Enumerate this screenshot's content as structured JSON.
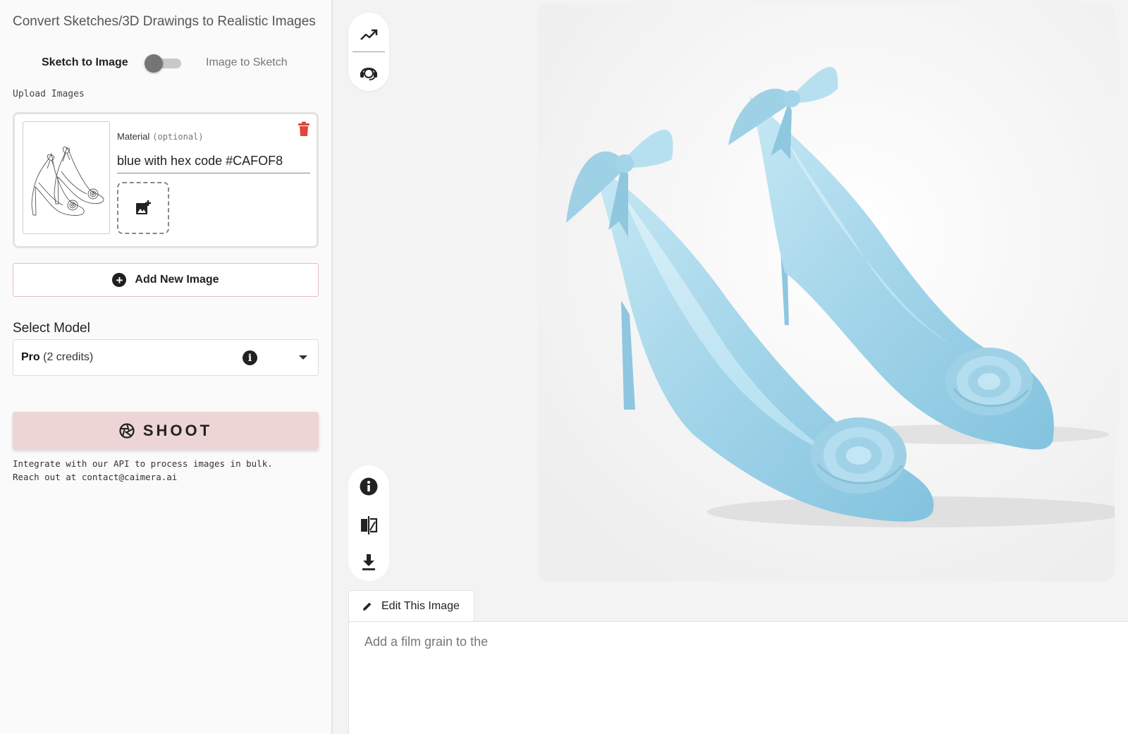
{
  "sidebar": {
    "title": "Convert Sketches/3D Drawings to Realistic Images",
    "mode_toggle": {
      "left_label": "Sketch to Image",
      "right_label": "Image to Sketch"
    },
    "upload_label": "Upload Images",
    "upload_card": {
      "material_label": "Material",
      "material_optional": "(optional)",
      "material_value": "blue with hex code #CAFOF8"
    },
    "add_new_image_label": "Add New Image",
    "select_model": {
      "label": "Select Model",
      "value_bold": "Pro",
      "value_rest": "(2 credits)"
    },
    "shoot_label": "SHOOT",
    "api_note_line1": "Integrate with our API to process images in bulk.",
    "api_note_line2": "Reach out at contact@caimera.ai"
  },
  "toolbar_top": [
    "trending-icon",
    "support-agent-icon"
  ],
  "toolbar_bottom": [
    "info-icon",
    "compare-icon",
    "download-icon"
  ],
  "edit": {
    "tab_label": "Edit This Image",
    "input_value": "Add a film grain to the"
  },
  "colors": {
    "shoot_bg": "#edd5d5",
    "add_border": "#e6bcc4",
    "trash": "#e0463a",
    "shoe_blue": "#a8d8ec"
  }
}
